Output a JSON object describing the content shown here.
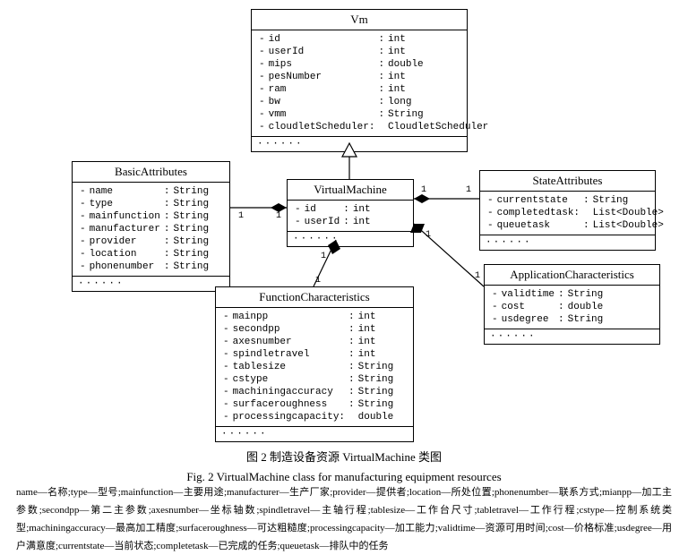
{
  "classes": {
    "vm": {
      "title": "Vm",
      "rows": [
        [
          "-",
          "id",
          ":",
          "int"
        ],
        [
          "-",
          "userId",
          ":",
          "int"
        ],
        [
          "-",
          "mips",
          ":",
          "double"
        ],
        [
          "-",
          "pesNumber",
          ":",
          "int"
        ],
        [
          "-",
          "ram",
          ":",
          "int"
        ],
        [
          "-",
          "bw",
          ":",
          "long"
        ],
        [
          "-",
          "vmm",
          ":",
          "String"
        ],
        [
          "-",
          "cloudletScheduler:",
          "",
          "CloudletScheduler"
        ]
      ]
    },
    "basic": {
      "title": "BasicAttributes",
      "rows": [
        [
          "-",
          "name",
          ":",
          "String"
        ],
        [
          "-",
          "type",
          ":",
          "String"
        ],
        [
          "-",
          "mainfunction",
          ":",
          "String"
        ],
        [
          "-",
          "manufacturer",
          ":",
          "String"
        ],
        [
          "-",
          "provider",
          ":",
          "String"
        ],
        [
          "-",
          "location",
          ":",
          "String"
        ],
        [
          "-",
          "phonenumber",
          ":",
          "String"
        ]
      ]
    },
    "virt": {
      "title": "VirtualMachine",
      "rows": [
        [
          "-",
          "id",
          ":",
          "int"
        ],
        [
          "-",
          "userId",
          ":",
          "int"
        ]
      ]
    },
    "state": {
      "title": "StateAttributes",
      "rows": [
        [
          "-",
          "currentstate",
          ":",
          "String"
        ],
        [
          "-",
          "completedtask:",
          "",
          "List<Double>"
        ],
        [
          "-",
          "queuetask",
          ":",
          "List<Double>"
        ]
      ]
    },
    "appchar": {
      "title": "ApplicationCharacteristics",
      "rows": [
        [
          "-",
          "validtime",
          ":",
          "String"
        ],
        [
          "-",
          "cost",
          ":",
          "double"
        ],
        [
          "-",
          "usdegree",
          ":",
          "String"
        ]
      ]
    },
    "func": {
      "title": "FunctionCharacteristics",
      "rows": [
        [
          "-",
          "mainpp",
          ":",
          "int"
        ],
        [
          "-",
          "secondpp",
          ":",
          "int"
        ],
        [
          "-",
          "axesnumber",
          ":",
          "int"
        ],
        [
          "-",
          "spindletravel",
          ":",
          "int"
        ],
        [
          "-",
          "tablesize",
          ":",
          "String"
        ],
        [
          "-",
          "cstype",
          ":",
          "String"
        ],
        [
          "-",
          "machiningaccuracy",
          ":",
          "String"
        ],
        [
          "-",
          "surfaceroughness",
          ":",
          "String"
        ],
        [
          "-",
          "processingcapacity:",
          "",
          "double"
        ]
      ]
    }
  },
  "caption_cn": "图 2  制造设备资源 VirtualMachine 类图",
  "caption_en": "Fig. 2  VirtualMachine class for manufacturing equipment resources",
  "legend": "name—名称;type—型号;mainfunction—主要用途;manufacturer—生产厂家;provider—提供者;location—所处位置;phonenumber—联系方式;mianpp—加工主参数;secondpp—第二主参数;axesnumber—坐标轴数;spindletravel—主轴行程;tablesize—工作台尺寸;tabletravel—工作行程;cstype—控制系统类型;machiningaccuracy—最高加工精度;surfaceroughness—可达粗糙度;processingcapacity—加工能力;validtime—资源可用时间;cost—价格标准;usdegree—用户满意度;currentstate—当前状态;completetask—已完成的任务;queuetask—排队中的任务",
  "mult": "1"
}
